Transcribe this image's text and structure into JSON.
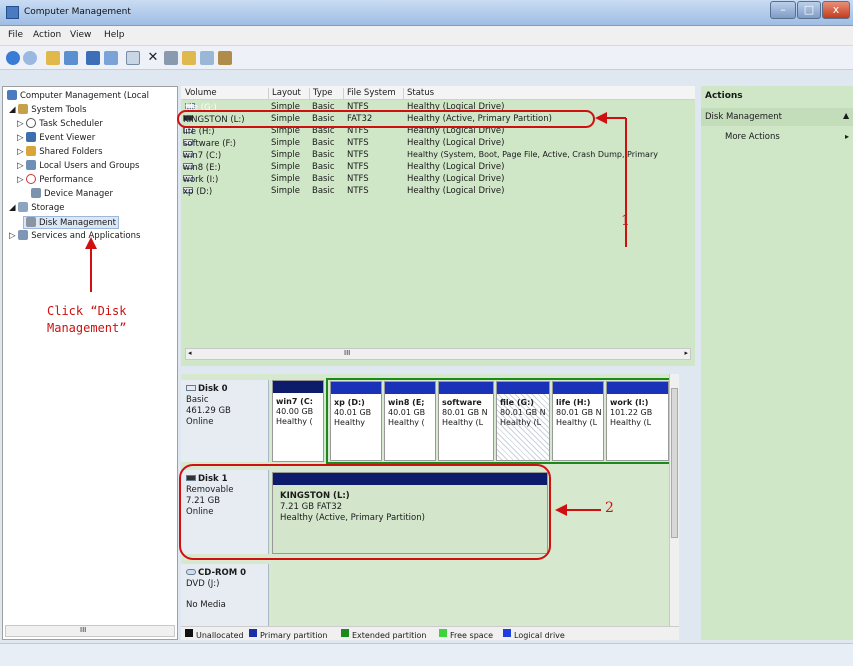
{
  "window": {
    "title": "Computer Management",
    "minimize": "–",
    "maximize": "□",
    "close": "x"
  },
  "menu": {
    "file": "File",
    "action": "Action",
    "view": "View",
    "help": "Help"
  },
  "tree": {
    "root": "Computer Management (Local",
    "system_tools": "System Tools",
    "task_scheduler": "Task Scheduler",
    "event_viewer": "Event Viewer",
    "shared_folders": "Shared Folders",
    "local_users": "Local Users and Groups",
    "performance": "Performance",
    "device_manager": "Device Manager",
    "storage": "Storage",
    "disk_management": "Disk Management",
    "services": "Services and Applications"
  },
  "annotations": {
    "click_line1": "Click  “Disk",
    "click_line2": "Management”",
    "num1": "1",
    "num2": "2"
  },
  "volume_table": {
    "headers": [
      "Volume",
      "Layout",
      "Type",
      "File System",
      "Status"
    ],
    "rows": [
      [
        "file (G:)",
        "Simple",
        "Basic",
        "NTFS",
        "Healthy (Logical Drive)"
      ],
      [
        "KINGSTON (L:)",
        "Simple",
        "Basic",
        "FAT32",
        "Healthy (Active, Primary Partition)"
      ],
      [
        "life (H:)",
        "Simple",
        "Basic",
        "NTFS",
        "Healthy (Logical Drive)"
      ],
      [
        "software (F:)",
        "Simple",
        "Basic",
        "NTFS",
        "Healthy (Logical Drive)"
      ],
      [
        "win7 (C:)",
        "Simple",
        "Basic",
        "NTFS",
        "Healthy (System, Boot, Page File, Active, Crash Dump, Primary"
      ],
      [
        "win8 (E:)",
        "Simple",
        "Basic",
        "NTFS",
        "Healthy (Logical Drive)"
      ],
      [
        "work (I:)",
        "Simple",
        "Basic",
        "NTFS",
        "Healthy (Logical Drive)"
      ],
      [
        "xp (D:)",
        "Simple",
        "Basic",
        "NTFS",
        "Healthy (Logical Drive)"
      ]
    ]
  },
  "disk0": {
    "name": "Disk 0",
    "type": "Basic",
    "size": "461.29 GB",
    "state": "Online",
    "partitions": [
      {
        "name": "win7 (C:",
        "size": "40.00 GB",
        "status": "Healthy ("
      },
      {
        "name": "xp (D:)",
        "size": "40.01 GB",
        "status": "Healthy"
      },
      {
        "name": "win8 (E;",
        "size": "40.01 GB",
        "status": "Healthy ("
      },
      {
        "name": "software",
        "size": "80.01 GB N",
        "status": "Healthy (L"
      },
      {
        "name": "file (G:)",
        "size": "80.01 GB N",
        "status": "Healthy (L"
      },
      {
        "name": "life (H:)",
        "size": "80.01 GB N",
        "status": "Healthy (L"
      },
      {
        "name": "work (I:)",
        "size": "101.22 GB",
        "status": "Healthy (L"
      }
    ]
  },
  "disk1": {
    "name": "Disk 1",
    "type": "Removable",
    "size": "7.21 GB",
    "state": "Online",
    "partition": {
      "name": "KINGSTON (L:)",
      "size": "7.21 GB FAT32",
      "status": "Healthy (Active, Primary Partition)"
    }
  },
  "cdrom": {
    "name": "CD-ROM 0",
    "drive": "DVD (J:)",
    "media": "No Media"
  },
  "legend": [
    "Unallocated",
    "Primary partition",
    "Extended partition",
    "Free space",
    "Logical drive"
  ],
  "actions": {
    "header": "Actions",
    "section": "Disk Management",
    "more": "More Actions"
  },
  "scroll": {
    "label": "III"
  },
  "colors": {
    "unallocated": "#111111",
    "primary": "#1a2fa6",
    "extended": "#1d8a1d",
    "free": "#3cd43c",
    "logical": "#1d3ee0"
  }
}
